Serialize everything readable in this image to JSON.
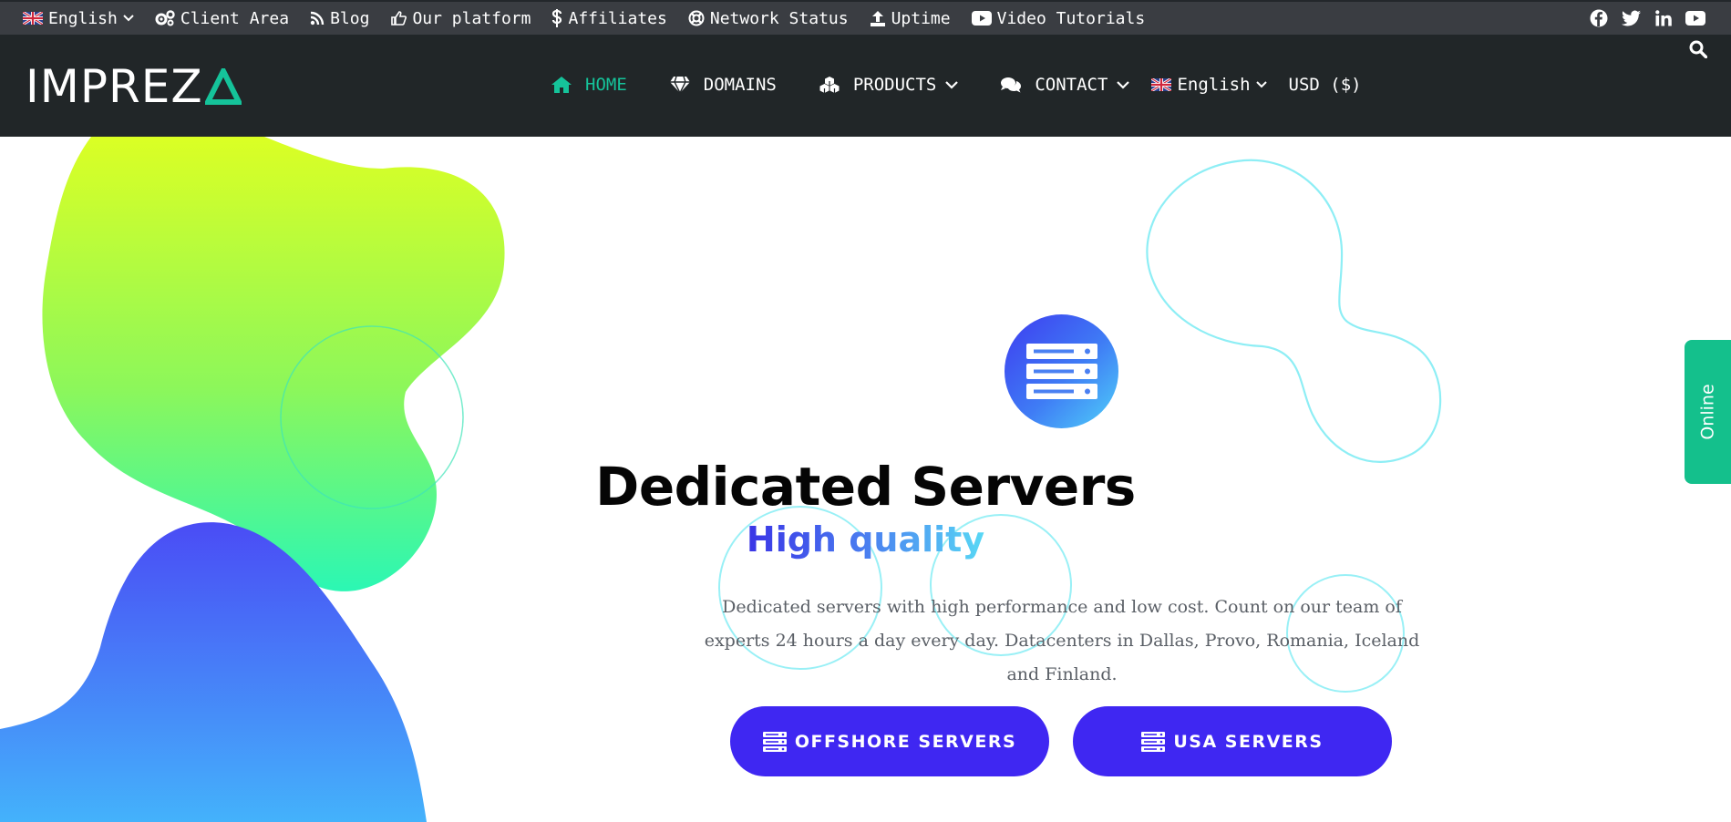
{
  "topbar": {
    "language": "English",
    "links": [
      {
        "label": "Client Area",
        "icon": "gears-icon"
      },
      {
        "label": "Blog",
        "icon": "rss-icon"
      },
      {
        "label": "Our platform",
        "icon": "hand-pointer-icon"
      },
      {
        "label": "Affiliates",
        "icon": "dollar-icon"
      },
      {
        "label": "Network Status",
        "icon": "lifebuoy-icon"
      },
      {
        "label": "Uptime",
        "icon": "upload-icon"
      },
      {
        "label": "Video Tutorials",
        "icon": "youtube-icon"
      }
    ],
    "social": [
      "facebook-icon",
      "twitter-icon",
      "linkedin-icon",
      "youtube-icon"
    ]
  },
  "header": {
    "logo_text": "IMPREZ",
    "nav": [
      {
        "label": "HOME",
        "icon": "home-icon",
        "active": true
      },
      {
        "label": "DOMAINS",
        "icon": "diamond-icon"
      },
      {
        "label": "PRODUCTS",
        "icon": "cubes-icon"
      },
      {
        "label": "CONTACT",
        "icon": "comments-icon"
      }
    ],
    "language": "English",
    "currency": "USD ($)"
  },
  "hero": {
    "title": "Dedicated Servers",
    "subtitle": "High quality",
    "description": "Dedicated servers with high performance and low cost. Count on our team of experts 24 hours a day every day. Datacenters in Dallas, Provo, Romania, Iceland and Finland.",
    "buttons": [
      {
        "label": "OFFSHORE SERVERS",
        "icon": "server-icon"
      },
      {
        "label": "USA SERVERS",
        "icon": "server-icon"
      }
    ]
  },
  "online_tab": "Online",
  "colors": {
    "topbar_bg": "#3a3d42",
    "header_bg": "#212628",
    "accent_green": "#15c39a",
    "button_purple": "#3f27f2",
    "online_green": "#14c08c"
  }
}
